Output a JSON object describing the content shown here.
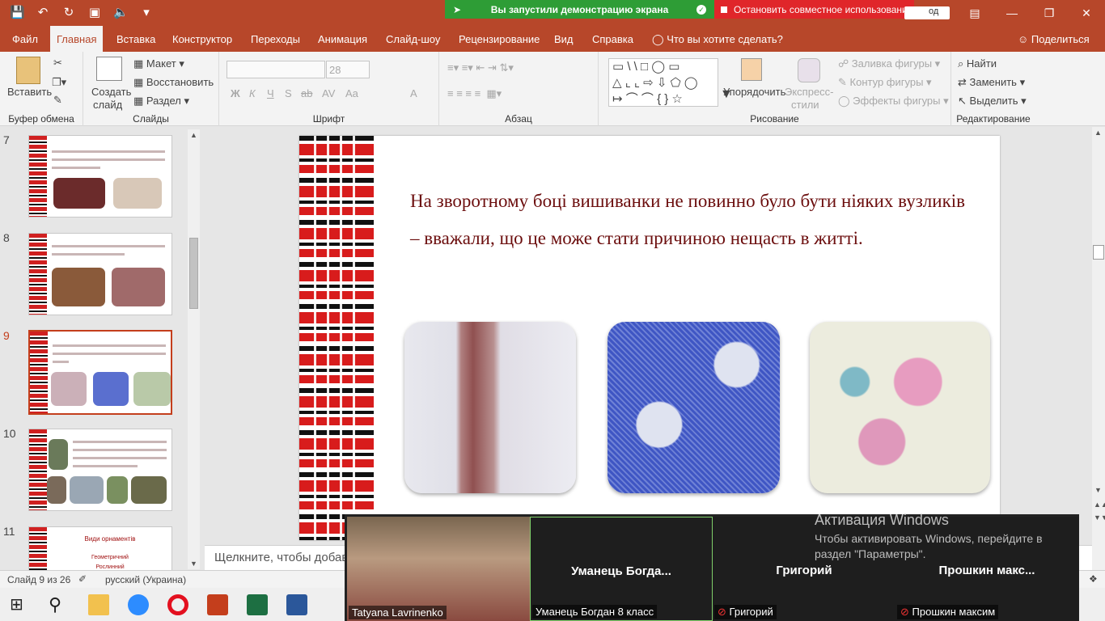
{
  "qat": {
    "icons": [
      "save-icon",
      "undo-icon",
      "redo-icon",
      "present-icon",
      "speaker-icon",
      "customize-icon"
    ]
  },
  "share": {
    "notice": "Вы запустили демонстрацию экрана",
    "stop": "Остановить совместное использование",
    "auth": "од"
  },
  "tabs": [
    "Файл",
    "Главная",
    "Вставка",
    "Конструктор",
    "Переходы",
    "Анимация",
    "Слайд-шоу",
    "Рецензирование",
    "Вид",
    "Справка",
    "Что вы хотите сделать?"
  ],
  "share_button": "Поделиться",
  "ribbon": {
    "clipboard": {
      "paste": "Вставить",
      "label": "Буфер обмена"
    },
    "slides": {
      "new_slide_1": "Создать",
      "new_slide_2": "слайд",
      "layout": "Макет",
      "reset": "Восстановить",
      "section": "Раздел",
      "label": "Слайды"
    },
    "font": {
      "size": "28",
      "label": "Шрифт",
      "buttons": [
        "Ж",
        "К",
        "Ч",
        "S",
        "ab",
        "AV",
        "Aa",
        "A"
      ]
    },
    "paragraph": {
      "label": "Абзац"
    },
    "drawing": {
      "arrange": "Упорядочить",
      "styles_1": "Экспресс-",
      "styles_2": "стили",
      "fill": "Заливка фигуры",
      "outline": "Контур фигуры",
      "effects": "Эффекты фигуры",
      "label": "Рисование"
    },
    "editing": {
      "find": "Найти",
      "replace": "Заменить",
      "select": "Выделить",
      "label": "Редактирование"
    }
  },
  "thumbnails": [
    {
      "num": "7",
      "text": "Вважалося, що чоловіки повинні носити вишиванку з вишивкою тільки у вигляді квадратів"
    },
    {
      "num": "8",
      "text": "У звичайних домотканих сорочках у шафі був 10 сорочок"
    },
    {
      "num": "9",
      "text": "На зворотному боці вишиванки не повинно було бути ніяких вузликів"
    },
    {
      "num": "10",
      "text": "Щороку в Україні у третій четвер травня відзначають День вишиванки"
    },
    {
      "num": "11",
      "text": "Види орнаментів",
      "sub1": "Геометричний",
      "sub2": "Рослинний"
    }
  ],
  "slide": {
    "text": "На зворотному боці вишиванки не повинно було бути ніяких вузликів – вважали, що це може стати причиною нещасть в житті."
  },
  "notes_placeholder": "Щелкните, чтобы добав",
  "status": {
    "slide": "Слайд 9 из 26",
    "language": "русский (Украина)"
  },
  "video": {
    "tiles": [
      {
        "label": "Tatyana Lavrinenko",
        "name": ""
      },
      {
        "label": "Уманець Богдан 8 класс",
        "name": "Уманець  Богда..."
      },
      {
        "label": "Григорий",
        "name": "Григорий"
      },
      {
        "label": "Прошкин максим",
        "name": "Прошкин  макс..."
      }
    ]
  },
  "watermark": {
    "title": "Активация Windows",
    "line1": "Чтобы активировать Windows, перейдите в",
    "line2": "раздел \"Параметры\"."
  },
  "taskbar": [
    "start-icon",
    "search-icon",
    "explorer-icon",
    "zoom-icon",
    "opera-icon",
    "powerpoint-icon",
    "excel-icon",
    "word-icon"
  ],
  "colors": {
    "accent": "#b7472a",
    "share_green": "#2e9d36",
    "share_red": "#e0262a",
    "slide_text": "#6b0d0d"
  }
}
